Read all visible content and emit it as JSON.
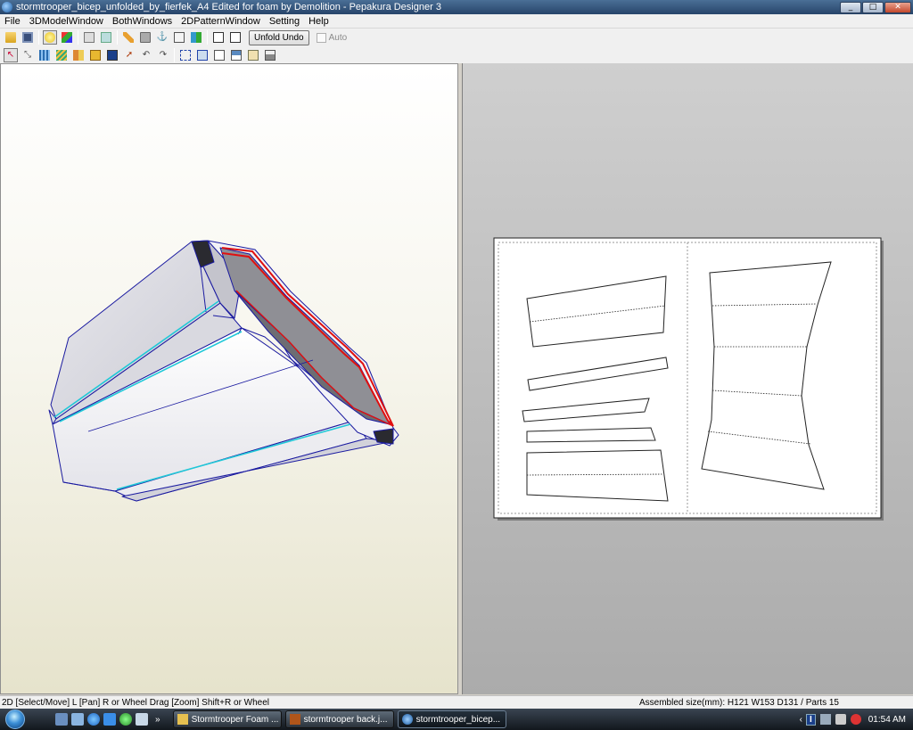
{
  "window": {
    "title": "stormtrooper_bicep_unfolded_by_fierfek_A4 Edited for foam by Demolition - Pepakura Designer 3",
    "minimize": "_",
    "maximize": "□",
    "close": "✕"
  },
  "menu": [
    "File",
    "3DModelWindow",
    "BothWindows",
    "2DPatternWindow",
    "Setting",
    "Help"
  ],
  "toolbar": {
    "unfold_undo_label": "Unfold Undo",
    "auto_label": "Auto",
    "auto_checked": false
  },
  "status": {
    "left": "2D [Select/Move] L [Pan] R or Wheel Drag [Zoom] Shift+R or Wheel",
    "right": "Assembled size(mm): H121 W153 D131 / Parts 15"
  },
  "taskbar": {
    "tasks": [
      "Stormtrooper Foam ...",
      "stormtrooper back.j...",
      "stormtrooper_bicep..."
    ],
    "active_task": 2,
    "clock": "01:54 AM",
    "lang": "I"
  },
  "colors": {
    "model_edge": "#1a1aa0",
    "selected_edge": "#e01010",
    "highlight_edge": "#20c8d8"
  }
}
